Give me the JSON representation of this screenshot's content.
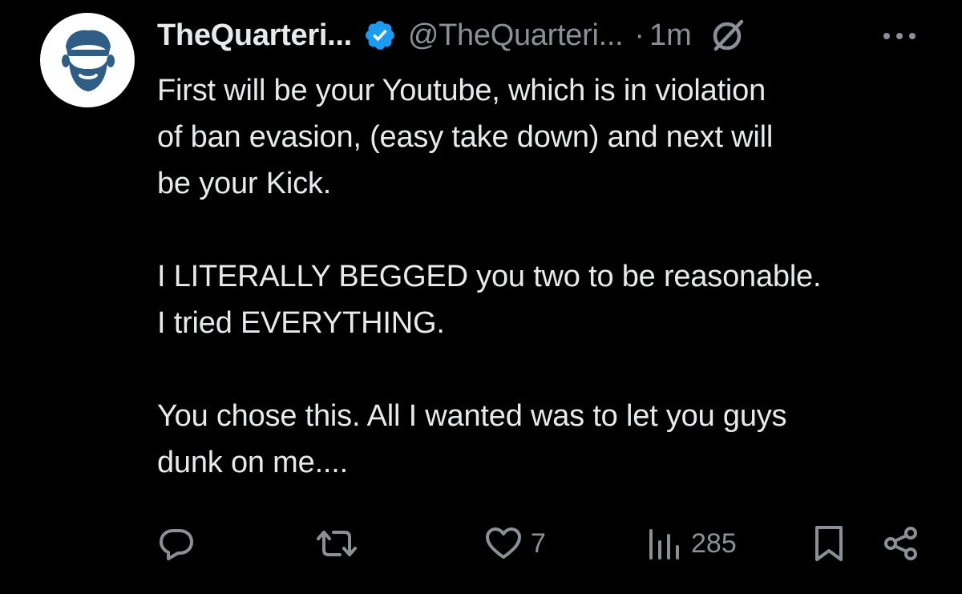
{
  "tweet": {
    "display_name": "TheQuarteri...",
    "handle": "@TheQuarteri...",
    "separator": "·",
    "time": "1m",
    "paragraphs": [
      "First will be your Youtube, which is in violation\nof ban evasion, (easy take down) and next will\nbe your Kick.",
      "I LITERALLY BEGGED you two to be reasonable.\nI tried EVERYTHING.",
      "You chose this.  All I wanted was to let you guys\ndunk on me...."
    ]
  },
  "actions": {
    "reply_icon": "reply-icon",
    "repost_icon": "repost-icon",
    "like_icon": "heart-icon",
    "like_count": "7",
    "views_icon": "views-icon",
    "views_count": "285",
    "bookmark_icon": "bookmark-icon",
    "share_icon": "share-icon"
  },
  "colors": {
    "background": "#000000",
    "text": "#e7e9ea",
    "secondary_text": "#8b9096",
    "verified_badge": "#1d9bf0",
    "avatar_figure": "#2f5d86"
  }
}
